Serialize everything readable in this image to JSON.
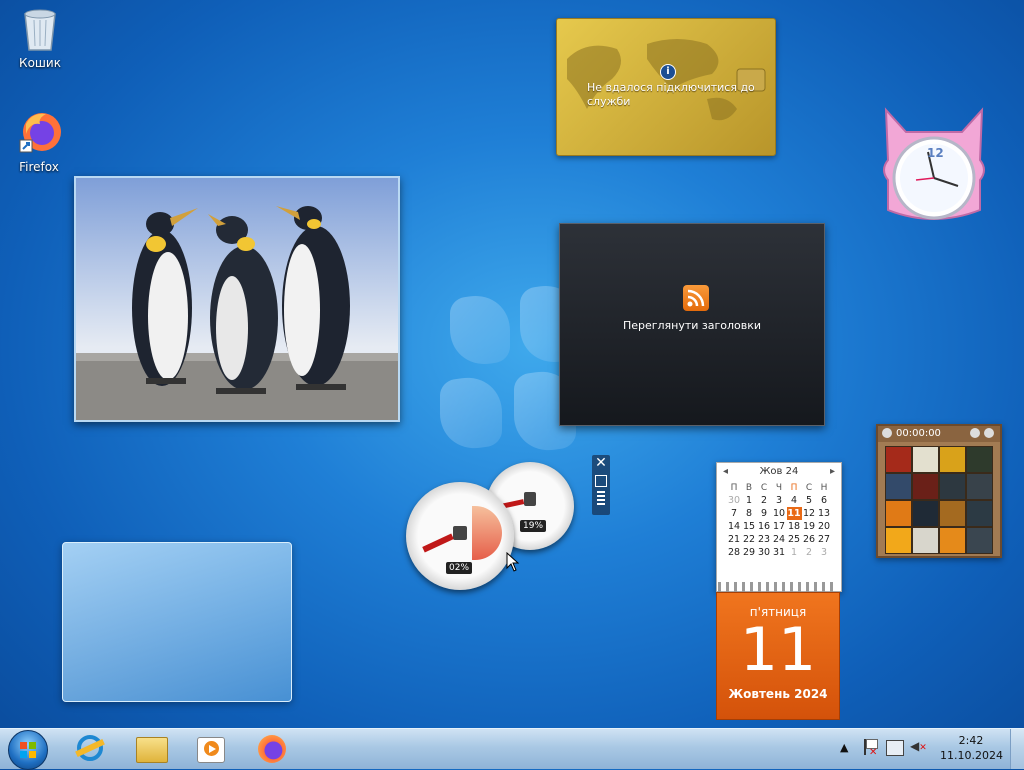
{
  "desktop": {
    "icons": [
      {
        "label": "Кошик",
        "icon": "recycle-bin-icon"
      },
      {
        "label": "Firefox",
        "icon": "firefox-icon"
      }
    ]
  },
  "gadgets": {
    "feed_info": {
      "message": "Не вдалося підключитися до служби",
      "icon": "info-icon"
    },
    "headlines": {
      "label": "Переглянути заголовки",
      "icon": "rss-icon"
    },
    "clock": {
      "number": "12"
    },
    "calendar": {
      "month": "Жов 24",
      "weekdays": [
        "П",
        "В",
        "С",
        "Ч",
        "П",
        "С",
        "Н"
      ],
      "weeks": [
        [
          "30",
          "1",
          "2",
          "3",
          "4",
          "5",
          "6"
        ],
        [
          "7",
          "8",
          "9",
          "10",
          "11",
          "12",
          "13"
        ],
        [
          "14",
          "15",
          "16",
          "17",
          "18",
          "19",
          "20"
        ],
        [
          "21",
          "22",
          "23",
          "24",
          "25",
          "26",
          "27"
        ],
        [
          "28",
          "29",
          "30",
          "31",
          "1",
          "2",
          "3"
        ]
      ],
      "today": "11",
      "day_name": "п'ятниця",
      "day_number": "11",
      "month_year": "Жовтень 2024"
    },
    "puzzle": {
      "timer": "00:00:00"
    },
    "cpu_meter": {
      "cpu": "02%",
      "ram": "19%"
    }
  },
  "taskbar": {
    "start": "start-orb",
    "pinned": [
      "internet-explorer-icon",
      "explorer-icon",
      "media-player-icon",
      "firefox-icon"
    ],
    "time": "2:42",
    "date": "11.10.2024"
  },
  "colors": {
    "accent_orange": "#e96a16",
    "taskbar": "#a9c8e4"
  }
}
